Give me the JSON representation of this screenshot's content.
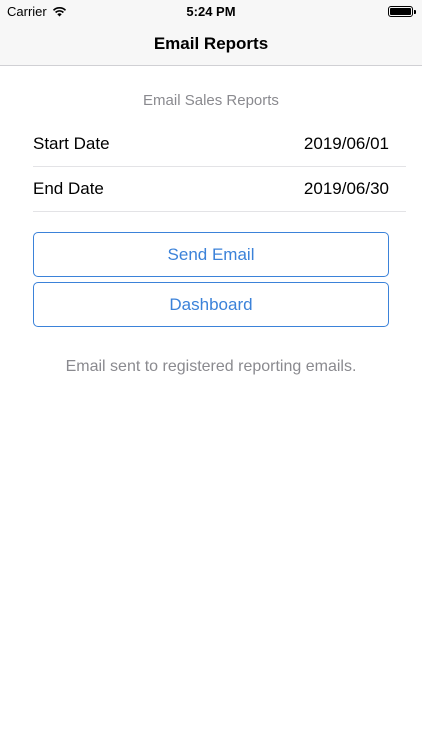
{
  "status_bar": {
    "carrier": "Carrier",
    "time": "5:24 PM",
    "icons": [
      "wifi-icon",
      "battery-icon"
    ]
  },
  "nav": {
    "title": "Email Reports"
  },
  "section": {
    "header": "Email Sales Reports"
  },
  "dates": {
    "start_label": "Start Date",
    "start_value": "2019/06/01",
    "end_label": "End Date",
    "end_value": "2019/06/30"
  },
  "buttons": {
    "send_email": "Send Email",
    "dashboard": "Dashboard"
  },
  "message": "Email sent to registered reporting emails.",
  "colors": {
    "accent": "#3b82d9",
    "secondary_text": "#8a8a8f",
    "bar_background": "#f7f7f7"
  }
}
